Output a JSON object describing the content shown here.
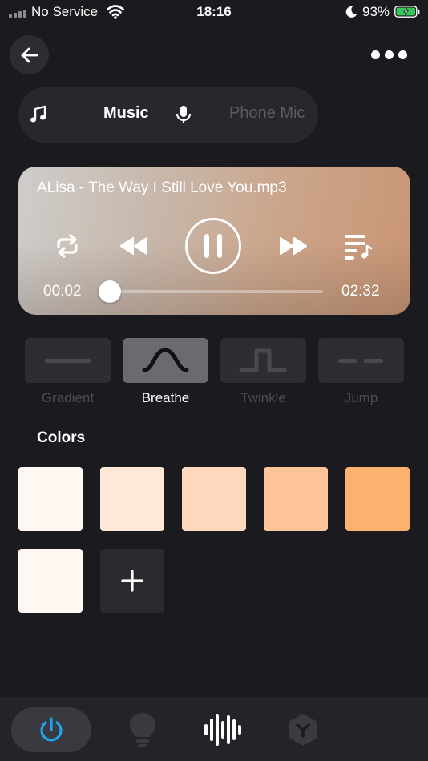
{
  "status_bar": {
    "carrier": "No Service",
    "time": "18:16",
    "battery": "93%"
  },
  "header": {
    "back_icon": "arrow-left-icon",
    "more_icon": "more-dots-icon"
  },
  "source": {
    "music_label": "Music",
    "mic_label": "Phone Mic",
    "selected": "Music"
  },
  "player": {
    "track_title": "ALisa - The Way I Still Love You.mp3",
    "current_time": "00:02",
    "total_time": "02:32",
    "progress": 0.013,
    "state": "playing"
  },
  "modes": [
    {
      "label": "Gradient",
      "icon": "flat-line-icon",
      "active": false
    },
    {
      "label": "Breathe",
      "icon": "wave-curve-icon",
      "active": true
    },
    {
      "label": "Twinkle",
      "icon": "pulse-step-icon",
      "active": false
    },
    {
      "label": "Jump",
      "icon": "dashed-line-icon",
      "active": false
    }
  ],
  "colors": {
    "title": "Colors",
    "swatches": [
      "#fff7f1",
      "#fee8d9",
      "#fed7bc",
      "#fdc49a",
      "#fcb26e",
      "#fff7f1"
    ]
  },
  "bottom_nav": {
    "items": [
      "power-icon",
      "bulb-icon",
      "sound-wave-icon",
      "hexagon-y-icon"
    ],
    "accent": "#1ea4f0"
  }
}
